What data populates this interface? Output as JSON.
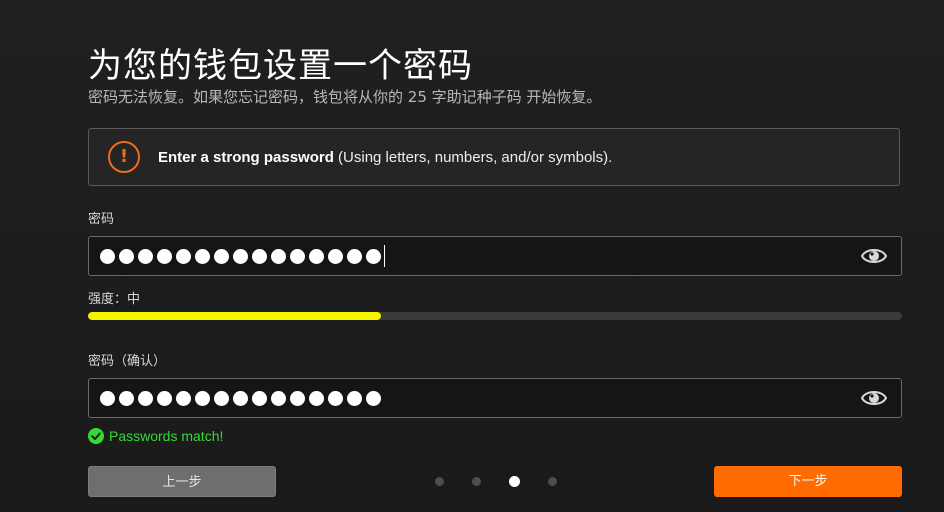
{
  "header": {
    "title": "为您的钱包设置一个密码",
    "subtitle": "密码无法恢复。如果您忘记密码，钱包将从你的 25 字助记种子码 开始恢复。"
  },
  "alert": {
    "icon": "exclamation-circle-icon",
    "bold_text": "Enter a strong password",
    "text": " (Using letters, numbers, and/or symbols).",
    "color": "#f26b1d"
  },
  "password": {
    "label": "密码",
    "masked_length": 15,
    "toggle_icon": "eye-icon"
  },
  "strength": {
    "label": "强度：中",
    "level": 0.36,
    "color": "#f5f500"
  },
  "confirm": {
    "label": "密码（确认）",
    "masked_length": 15,
    "toggle_icon": "eye-icon"
  },
  "match": {
    "text": "Passwords match!",
    "icon": "check-circle-icon",
    "color": "#35d935"
  },
  "footer": {
    "back_label": "上一步",
    "next_label": "下一步",
    "steps_total": 4,
    "current_step": 3,
    "accent": "#ff6b00"
  }
}
